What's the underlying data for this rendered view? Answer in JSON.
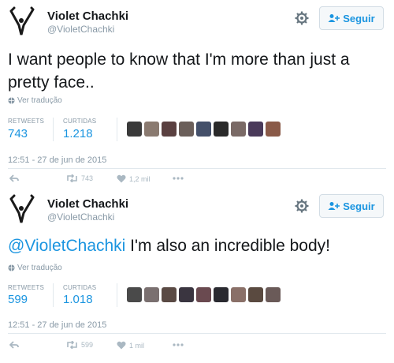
{
  "tweets": [
    {
      "name": "Violet Chachki",
      "handle": "@VioletChachki",
      "follow_label": "Seguir",
      "text": "I want people to know that I'm more than just a pretty face..",
      "mention": "",
      "translate": "Ver tradução",
      "retweets_label": "RETWEETS",
      "retweets": "743",
      "likes_label": "CURTIDAS",
      "likes": "1.218",
      "timestamp": "12:51 - 27 de jun de 2015",
      "action_retweets": "743",
      "action_likes": "1,2 mil",
      "face_colors": [
        "#3a3a3a",
        "#8a7a70",
        "#5a4040",
        "#6b5f5a",
        "#44506a",
        "#2a2a2a",
        "#7a6a66",
        "#4a3a5a",
        "#8a5a48"
      ]
    },
    {
      "name": "Violet Chachki",
      "handle": "@VioletChachki",
      "follow_label": "Seguir",
      "text": " I'm also an incredible body!",
      "mention": "@VioletChachki",
      "translate": "Ver tradução",
      "retweets_label": "RETWEETS",
      "retweets": "599",
      "likes_label": "CURTIDAS",
      "likes": "1.018",
      "timestamp": "12:51 - 27 de jun de 2015",
      "action_retweets": "599",
      "action_likes": "1 mil",
      "face_colors": [
        "#4a4a4a",
        "#7a7070",
        "#5a4a44",
        "#3a3540",
        "#6a4a50",
        "#2a2a30",
        "#8a7068",
        "#5a4a40",
        "#6a5a58"
      ]
    }
  ],
  "colors": {
    "accent": "#1b95e0",
    "muted": "#8899a6",
    "icon": "#aab8c2"
  },
  "icons": {
    "avatar": "avatar-icon",
    "gear": "gear-icon",
    "follow": "add-user-icon",
    "globe": "globe-icon",
    "reply": "reply-icon",
    "retweet": "retweet-icon",
    "like": "heart-icon",
    "more": "more-icon"
  }
}
